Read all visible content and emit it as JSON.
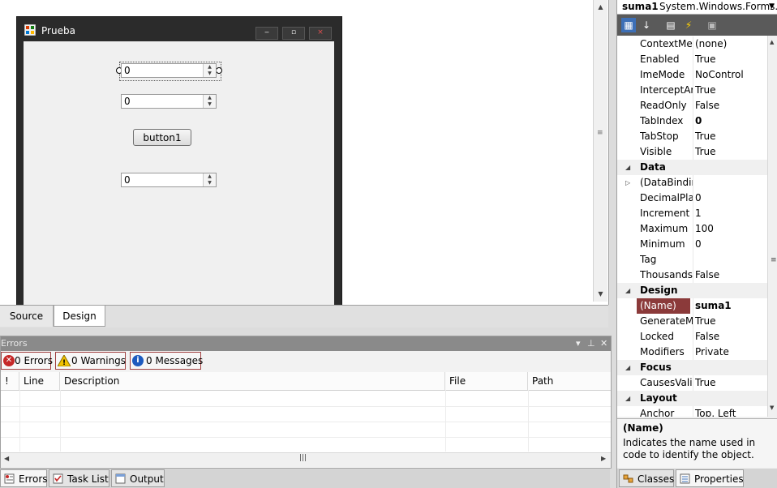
{
  "designer": {
    "form": {
      "title": "Prueba",
      "minimize": "‒",
      "maximize": "▫",
      "close": "×",
      "numeric1": "0",
      "numeric2": "0",
      "numeric3": "0",
      "button1": "button1"
    },
    "tabs": {
      "source": "Source",
      "design": "Design"
    }
  },
  "errors_panel": {
    "title": "Errors",
    "filters": {
      "errors": "0 Errors",
      "warnings": "0 Warnings",
      "messages": "0 Messages"
    },
    "columns": [
      "!",
      "Line",
      "Description",
      "File",
      "Path"
    ],
    "rows": []
  },
  "bottom_tabs": [
    "Errors",
    "Task List",
    "Output"
  ],
  "properties": {
    "object_name": "suma1",
    "object_type": "System.Windows.Forms.",
    "rows": [
      {
        "name": "ContextMen",
        "value": "(none)"
      },
      {
        "name": "Enabled",
        "value": "True"
      },
      {
        "name": "ImeMode",
        "value": "NoControl"
      },
      {
        "name": "InterceptArr",
        "value": "True"
      },
      {
        "name": "ReadOnly",
        "value": "False"
      },
      {
        "name": "TabIndex",
        "value": "0"
      },
      {
        "name": "TabStop",
        "value": "True"
      },
      {
        "name": "Visible",
        "value": "True"
      },
      {
        "name": "Data",
        "value": "",
        "category": true
      },
      {
        "name": "(DataBindin",
        "value": "",
        "expandable": true
      },
      {
        "name": "DecimalPlac",
        "value": "0"
      },
      {
        "name": "Increment",
        "value": "1"
      },
      {
        "name": "Maximum",
        "value": "100"
      },
      {
        "name": "Minimum",
        "value": "0"
      },
      {
        "name": "Tag",
        "value": ""
      },
      {
        "name": "ThousandsS",
        "value": "False"
      },
      {
        "name": "Design",
        "value": "",
        "category": true
      },
      {
        "name": "(Name)",
        "value": "suma1",
        "selected": true
      },
      {
        "name": "GenerateMe",
        "value": "True"
      },
      {
        "name": "Locked",
        "value": "False"
      },
      {
        "name": "Modifiers",
        "value": "Private"
      },
      {
        "name": "Focus",
        "value": "",
        "category": true
      },
      {
        "name": "CausesValid",
        "value": "True"
      },
      {
        "name": "Layout",
        "value": "",
        "category": true
      },
      {
        "name": "Anchor",
        "value": "Top, Left"
      }
    ],
    "description_title": "(Name)",
    "description_text": "Indicates the name used in code to identify the object.",
    "tabs": [
      "Classes",
      "Properties"
    ]
  },
  "colors": {
    "selection": "#8b3a3a",
    "panel_header": "#8a8a8a",
    "toolbar_dark": "#5a5a5a"
  }
}
